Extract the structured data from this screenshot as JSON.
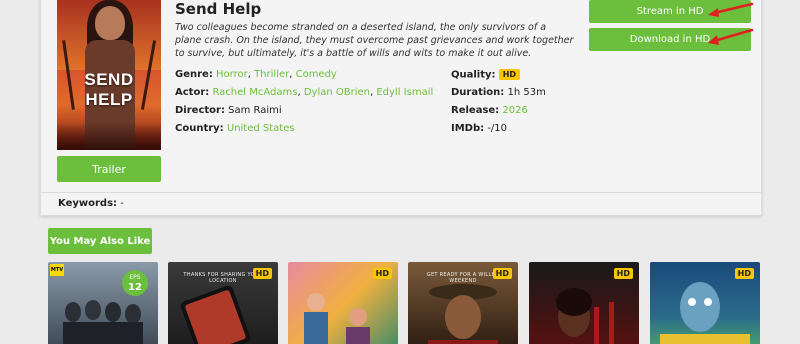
{
  "movie": {
    "title": "Send Help",
    "poster_title": "SEND HELP",
    "description": "Two colleagues become stranded on a deserted island, the only survivors of a plane crash. On the island, they must overcome past grievances and work together to survive, but ultimately, it's a battle of wills and wits to make it out alive.",
    "trailer_label": "Trailer",
    "genre_label": "Genre:",
    "genres": [
      "Horror",
      "Thriller",
      "Comedy"
    ],
    "actor_label": "Actor:",
    "actors": [
      "Rachel McAdams",
      "Dylan OBrien",
      "Edyll Ismail"
    ],
    "director_label": "Director:",
    "director": "Sam Raimi",
    "country_label": "Country:",
    "country": "United States",
    "quality_label": "Quality:",
    "quality": "HD",
    "duration_label": "Duration:",
    "duration": "1h 53m",
    "release_label": "Release:",
    "release": "2026",
    "imdb_label": "IMDb:",
    "imdb": "-/10"
  },
  "actions": {
    "stream_label": "Stream in HD",
    "download_label": "Download in HD"
  },
  "keywords": {
    "label": "Keywords:",
    "value": "-"
  },
  "related": {
    "heading": "You May Also Like",
    "cards": [
      {
        "badge": "",
        "eps_label": "EPS",
        "eps_value": "12",
        "logo": "MTV",
        "colors": [
          "#7a8a9a",
          "#3a4450"
        ]
      },
      {
        "badge": "HD",
        "caption": "THANKS FOR SHARING YOUR LOCATION",
        "colors": [
          "#3a3a3a",
          "#1b1b1b"
        ]
      },
      {
        "badge": "HD",
        "colors": [
          "#d86a8a",
          "#3a8a6a"
        ]
      },
      {
        "badge": "HD",
        "caption": "GET READY FOR A WILLED WEEKEND",
        "colors": [
          "#6a4a2a",
          "#2a1a10"
        ]
      },
      {
        "badge": "HD",
        "colors": [
          "#2a2a2a",
          "#8a1a1a"
        ]
      },
      {
        "badge": "HD",
        "colors": [
          "#1a4a7a",
          "#4aaa6a"
        ]
      }
    ]
  },
  "colors": {
    "accent": "#6cbf3c",
    "badge": "#f7c600",
    "arrow": "#e02020"
  }
}
